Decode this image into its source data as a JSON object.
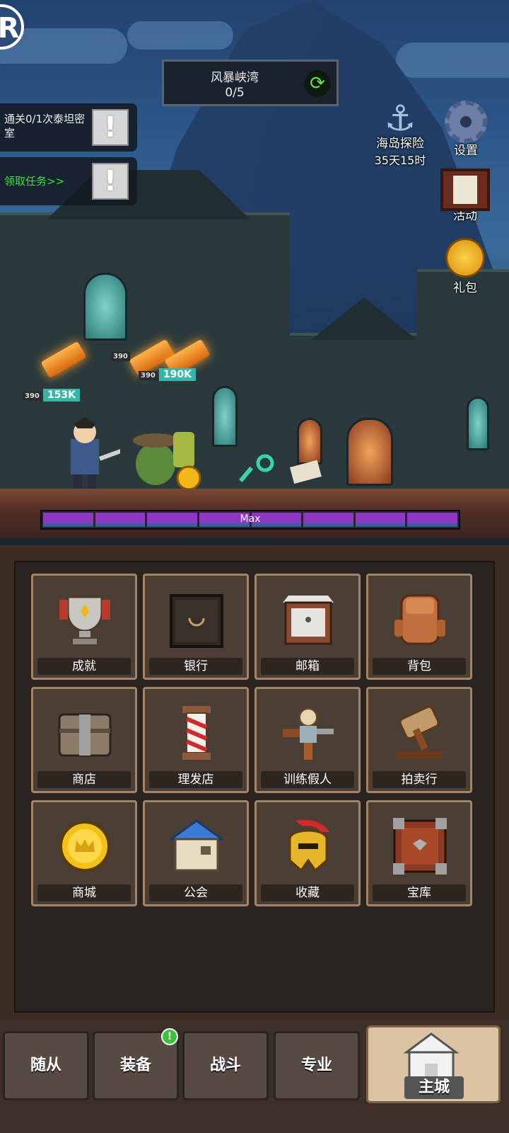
{
  "top": {
    "logo": "R",
    "location": {
      "name": "风暴峡湾",
      "progress": "0/5",
      "refresh_icon": "refresh-icon"
    }
  },
  "quests": [
    {
      "text": "通关0/1次泰坦密室",
      "icon": "exclamation-icon"
    },
    {
      "text": "领取任务>>",
      "icon": "exclamation-icon",
      "color": "#39e23b"
    }
  ],
  "side_buttons": {
    "island": {
      "label": "海岛探险",
      "timer": "35天15时",
      "icon": "anchor-icon"
    },
    "settings": {
      "label": "设置",
      "icon": "gear-icon"
    },
    "events": {
      "label": "活动",
      "icon": "notice-board-icon"
    },
    "gift": {
      "label": "礼包",
      "icon": "helmet-coin-icon"
    }
  },
  "battle": {
    "damage_tags": [
      {
        "level": "390",
        "value": "153K"
      },
      {
        "level": "390",
        "value": ""
      },
      {
        "level": "390",
        "value": "190K"
      }
    ],
    "progress_label": "Max",
    "progress_segments": 8
  },
  "city": {
    "tiles": [
      {
        "label": "成就",
        "icon": "trophy-icon"
      },
      {
        "label": "银行",
        "icon": "vault-icon"
      },
      {
        "label": "邮箱",
        "icon": "mailbox-icon"
      },
      {
        "label": "背包",
        "icon": "backpack-icon"
      },
      {
        "label": "商店",
        "icon": "chest-icon"
      },
      {
        "label": "理发店",
        "icon": "barber-pole-icon"
      },
      {
        "label": "训练假人",
        "icon": "training-dummy-icon"
      },
      {
        "label": "拍卖行",
        "icon": "gavel-icon"
      },
      {
        "label": "商城",
        "icon": "crown-coin-icon"
      },
      {
        "label": "公会",
        "icon": "guild-house-icon"
      },
      {
        "label": "收藏",
        "icon": "spartan-helmet-icon"
      },
      {
        "label": "宝库",
        "icon": "treasury-box-icon"
      }
    ]
  },
  "nav": {
    "items": [
      {
        "label": "随从"
      },
      {
        "label": "装备",
        "badge": "!"
      },
      {
        "label": "战斗"
      },
      {
        "label": "专业"
      },
      {
        "label": "主城",
        "active": true,
        "icon": "castle-icon"
      }
    ]
  }
}
